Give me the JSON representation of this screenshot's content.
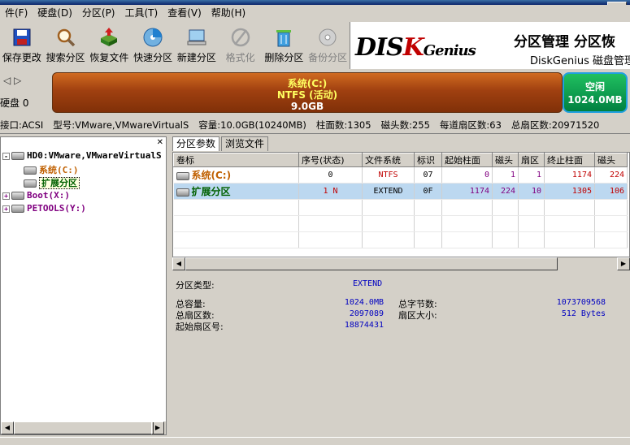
{
  "menu": [
    "件(F)",
    "硬盘(D)",
    "分区(P)",
    "工具(T)",
    "查看(V)",
    "帮助(H)"
  ],
  "toolbar": [
    {
      "label": "保存更改",
      "icon": "save-icon",
      "enabled": true
    },
    {
      "label": "搜索分区",
      "icon": "search-icon",
      "enabled": true
    },
    {
      "label": "恢复文件",
      "icon": "recover-icon",
      "enabled": true
    },
    {
      "label": "快速分区",
      "icon": "quick-partition-icon",
      "enabled": true
    },
    {
      "label": "新建分区",
      "icon": "new-partition-icon",
      "enabled": true
    },
    {
      "label": "格式化",
      "icon": "format-icon",
      "enabled": false
    },
    {
      "label": "删除分区",
      "icon": "delete-icon",
      "enabled": true
    },
    {
      "label": "备份分区",
      "icon": "backup-icon",
      "enabled": false
    }
  ],
  "banner": {
    "logo_dis": "DIS",
    "logo_k": "K",
    "logo_genius": "Genius",
    "line1": "分区管理 分区恢",
    "line2": "DiskGenius 磁盘管理"
  },
  "diskmap": {
    "disk_label": "硬盘 0",
    "system": {
      "name": "系统(C:)",
      "fs": "NTFS (活动)",
      "size": "9.0GB"
    },
    "free": {
      "name": "空闲",
      "size": "1024.0MB"
    }
  },
  "info": {
    "iface": "接口:ACSI",
    "model": "型号:VMware,VMwareVirtualS",
    "capacity": "容量:10.0GB(10240MB)",
    "cyl": "柱面数:1305",
    "heads": "磁头数:255",
    "sectors": "每道扇区数:63",
    "total": "总扇区数:20971520"
  },
  "tree": {
    "hdd": "HD0:VMware,VMwareVirtualS",
    "sys": "系统(C:)",
    "ext": "扩展分区",
    "boot": "Boot(X:)",
    "pe": "PETOOLS(Y:)"
  },
  "tabs": [
    "分区参数",
    "浏览文件"
  ],
  "table": {
    "headers": [
      "卷标",
      "序号(状态)",
      "文件系统",
      "标识",
      "起始柱面",
      "磁头",
      "扇区",
      "终止柱面",
      "磁头"
    ],
    "rows": [
      [
        "系统(C:)",
        "0",
        "NTFS",
        "07",
        "0",
        "1",
        "1",
        "1174",
        "224"
      ],
      [
        "扩展分区",
        "1 N",
        "EXTEND",
        "0F",
        "1174",
        "224",
        "10",
        "1305",
        "106"
      ]
    ]
  },
  "detail": {
    "type_label": "分区类型:",
    "type_value": "EXTEND",
    "cap_label": "总容量:",
    "cap_value": "1024.0MB",
    "bytes_label": "总字节数:",
    "bytes_value": "1073709568",
    "sectors_label": "总扇区数:",
    "sectors_value": "2097089",
    "secsize_label": "扇区大小:",
    "secsize_value": "512 Bytes",
    "start_label": "起始扇区号:",
    "start_value": "18874431"
  }
}
